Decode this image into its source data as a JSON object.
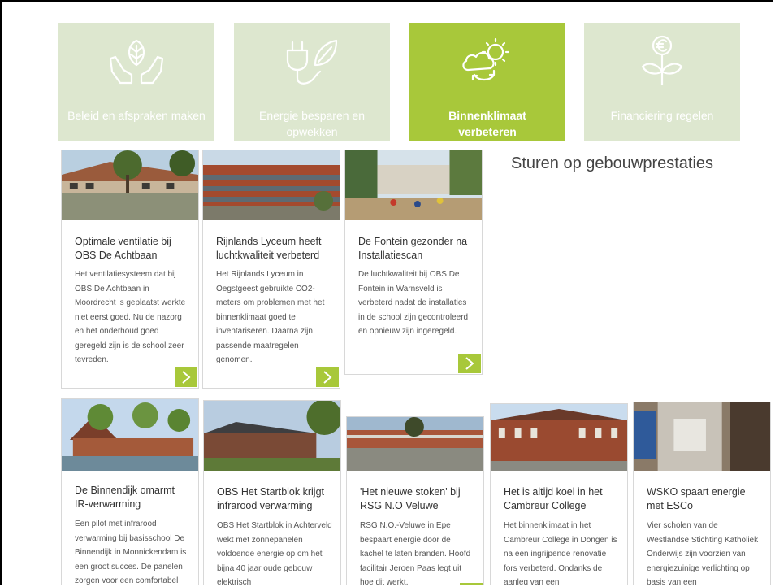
{
  "tiles": [
    {
      "label": "Beleid en afspraken maken",
      "icon": "hands-leaf-icon",
      "active": false
    },
    {
      "label": "Energie besparen en opwekken",
      "icon": "plug-leaf-icon",
      "active": false
    },
    {
      "label": "Binnenklimaat verbeteren",
      "icon": "sun-cloud-icon",
      "active": true
    },
    {
      "label": "Financiering regelen",
      "icon": "euro-plant-icon",
      "active": false
    }
  ],
  "side_title": "Sturen op gebouwprestaties",
  "cards_row1": [
    {
      "title": "Optimale ventilatie bij OBS De Achtbaan",
      "text": "Het ventilatiesysteem dat bij OBS De Achtbaan in Moordrecht is geplaatst werkte niet eerst goed. Nu de nazorg en het onderhoud goed geregeld zijn is de school zeer tevreden."
    },
    {
      "title": "Rijnlands Lyceum heeft luchtkwaliteit verbeterd",
      "text": "Het Rijnlands Lyceum in Oegstgeest gebruikte CO2-meters om problemen met het binnenklimaat goed te inventariseren. Daarna zijn passende maatregelen genomen."
    },
    {
      "title": "De Fontein gezonder na Installatiescan",
      "text": "De luchtkwaliteit bij OBS De Fontein in Warnsveld is verbeterd nadat de installaties in de school zijn gecontroleerd en opnieuw zijn ingeregeld."
    }
  ],
  "cards_row2": [
    {
      "title": "De Binnendijk omarmt IR-verwarming",
      "text": "Een pilot met infrarood verwarming bij basisschool De Binnendijk in Monnickendam is een groot succes. De panelen zorgen voor een comfortabel"
    },
    {
      "title": "OBS Het Startblok krijgt infrarood verwarming",
      "text": "OBS Het Startblok in Achterveld wekt met zonnepanelen voldoende energie op om het bijna 40 jaar oude gebouw elektrisch"
    },
    {
      "title": "'Het nieuwe stoken' bij RSG N.O Veluwe",
      "text": "RSG N.O.-Veluwe in Epe bespaart energie door de kachel te laten branden. Hoofd facilitair Jeroen Paas legt uit hoe dit werkt."
    },
    {
      "title": "Het is altijd koel in het Cambreur College",
      "text": "Het binnenklimaat in het Cambreur College in Dongen is na een ingrijpende renovatie fors verbeterd. Ondanks de aanleg van een"
    },
    {
      "title": "WSKO spaart energie met ESCo",
      "text": "Vier scholen van de Westlandse Stichting Katholiek Onderwijs zijn voorzien van energiezuinige verlichting op basis van een"
    }
  ],
  "colors": {
    "accent": "#a8c83a",
    "tile_bg": "#dde7cf"
  }
}
